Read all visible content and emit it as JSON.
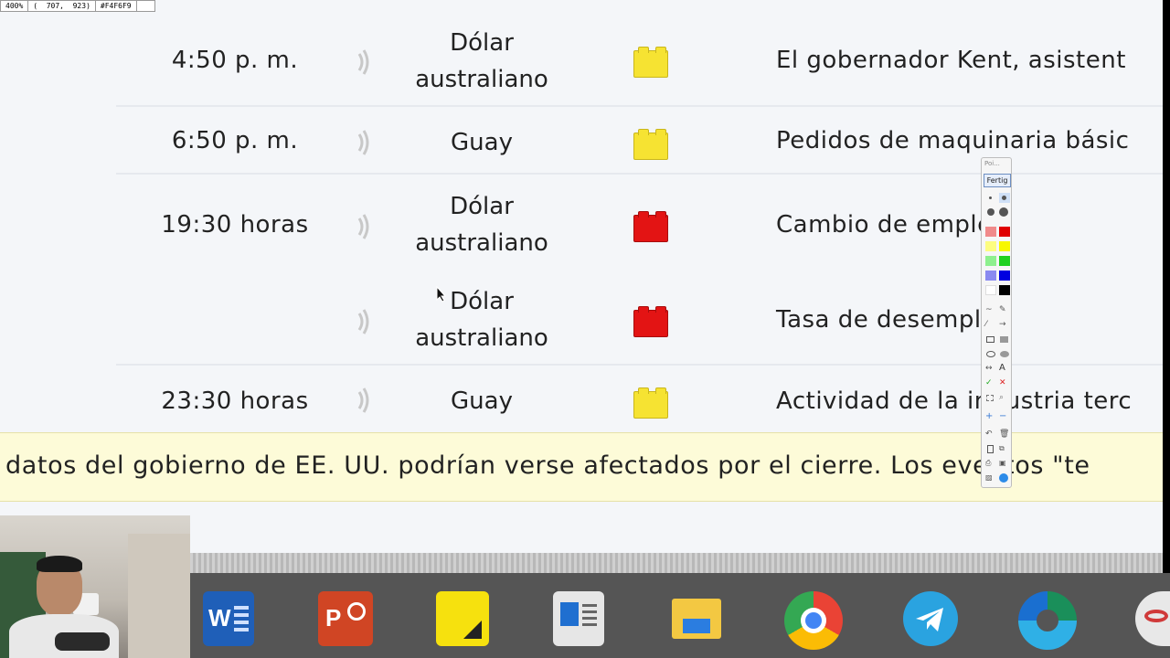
{
  "zoom_info": {
    "zoom": "400%",
    "coords": "(  707,  923)",
    "color_hex": "#F4F6F9"
  },
  "calendar": {
    "rows": [
      {
        "time": "4:50 p. m.",
        "currency": "Dólar australiano",
        "importance": "yellow",
        "event": "El gobernador Kent, asistent"
      },
      {
        "time": "6:50 p. m.",
        "currency": "Guay",
        "importance": "yellow",
        "event": "Pedidos de maquinaria básic"
      },
      {
        "time": "19:30 horas",
        "currency": "Dólar australiano",
        "importance": "red",
        "event": "Cambio de empleo"
      },
      {
        "time": "",
        "currency": "Dólar australiano",
        "importance": "red",
        "event": "Tasa de desempleo"
      },
      {
        "time": "23:30 horas",
        "currency": "Guay",
        "importance": "yellow",
        "event": "Actividad de la industria terc"
      }
    ]
  },
  "ticker": {
    "text": "datos del gobierno de EE. UU. podrían verse afectados por el cierre. Los eventos \"te"
  },
  "palette": {
    "header": "Poi...",
    "done_label": "Fertig",
    "text_tool": "A"
  },
  "colors": {
    "yellow": "#f6e332",
    "red": "#e31414",
    "background": "#f4f6f9",
    "ticker_bg": "#fdfbd8"
  },
  "taskbar": {
    "apps": [
      "word-icon",
      "powerpoint-icon",
      "sticky-notes-icon",
      "news-icon",
      "file-explorer-icon",
      "chrome-icon",
      "telegram-icon",
      "edge-icon",
      "app-icon-partial"
    ]
  }
}
